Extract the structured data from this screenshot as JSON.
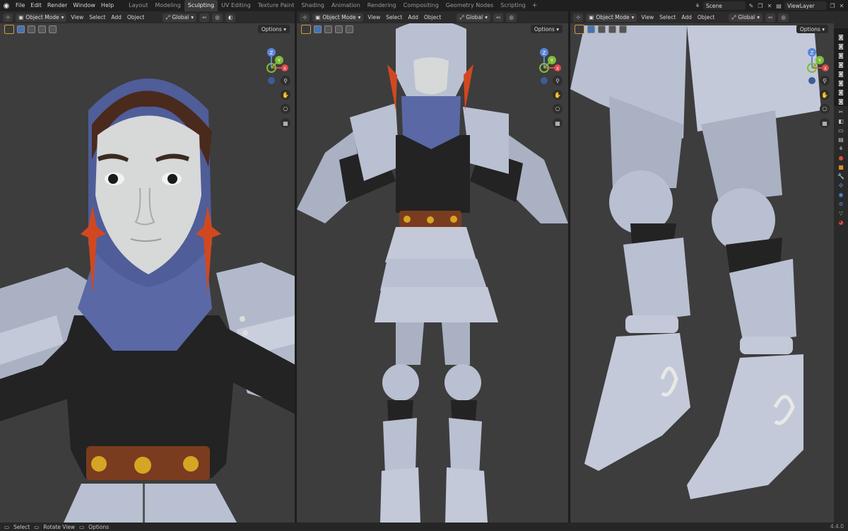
{
  "menu": [
    "File",
    "Edit",
    "Render",
    "Window",
    "Help"
  ],
  "workspaces": [
    "Layout",
    "Modeling",
    "Sculpting",
    "UV Editing",
    "Texture Paint",
    "Shading",
    "Animation",
    "Rendering",
    "Compositing",
    "Geometry Nodes",
    "Scripting"
  ],
  "active_workspace": "Sculpting",
  "add_tab": "+",
  "scene": "Scene",
  "view_layer": "ViewLayer",
  "viewport": {
    "mode": "Object Mode",
    "menus": [
      "View",
      "Select",
      "Add",
      "Object"
    ],
    "orientation": "Global",
    "options": "Options",
    "gizmo": {
      "z": "Z",
      "y": "Y",
      "x": "X"
    }
  },
  "status": {
    "select": "Select",
    "rotate": "Rotate View",
    "options": "Options",
    "version": "4.4.0"
  },
  "colors": {
    "skin": "#d7d8d8",
    "armor": "#b9c0d1",
    "suit": "#232323",
    "neck": "#5a68a5",
    "hair": "#4a2a1d",
    "earring": "#d14820",
    "belt": "#7a3c1f",
    "gold": "#d6a523",
    "bg": "#3d3d3d"
  }
}
